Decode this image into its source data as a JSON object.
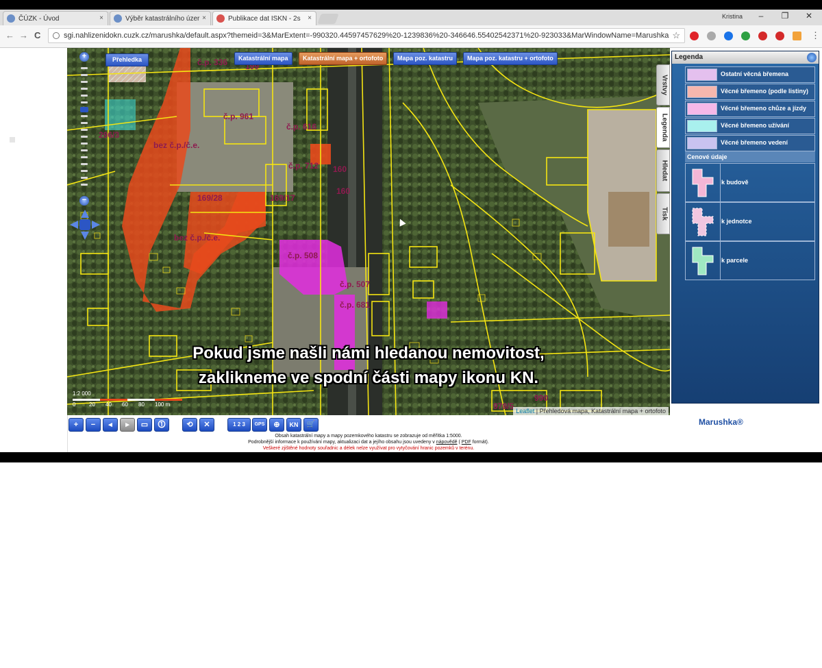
{
  "browser": {
    "tabs": [
      {
        "label": "ČÚZK - Úvod",
        "close": "×"
      },
      {
        "label": "Výběr katastrálního úzer",
        "close": "×"
      },
      {
        "label": "Publikace dat ISKN - 2s",
        "close": "×"
      }
    ],
    "user": "Kristina",
    "window_controls": [
      "–",
      "❐",
      "✕"
    ],
    "nav": {
      "back": "←",
      "forward": "→",
      "reload": "C"
    },
    "url": "sgi.nahlizenidokn.cuzk.cz/marushka/default.aspx?themeid=3&MarExtent=-990320.44597457629%20-1239836%20-346646.55402542371%20-923033&MarWindowName=Marushka",
    "star": "☆",
    "menu": "⋮",
    "extension_colors": [
      "#e0242a",
      "#aaaaaa",
      "#1a73e8",
      "#2ea043",
      "#d42a2a",
      "#d42a2a",
      "#f2a23a"
    ]
  },
  "map": {
    "layer_buttons": [
      {
        "label": "Přehledka",
        "active": false
      },
      {
        "label": "Katastrální mapa",
        "active": false
      },
      {
        "label": "Katastrální mapa + ortofoto",
        "active": true
      },
      {
        "label": "Mapa poz. katastru",
        "active": false
      },
      {
        "label": "Mapa poz. katastru + ortofoto",
        "active": false
      }
    ],
    "zoom": {
      "plus": "+",
      "minus": "−"
    },
    "labels": [
      {
        "text": "č.p. 336",
        "key": "cp336"
      },
      {
        "text": "199",
        "key": "n199"
      },
      {
        "text": "č.p. 961",
        "key": "cp961"
      },
      {
        "text": "č.p. 616",
        "key": "cp616"
      },
      {
        "text": "č.p. 712",
        "key": "cp712"
      },
      {
        "text": "160",
        "key": "n160a"
      },
      {
        "text": "160",
        "key": "n160b"
      },
      {
        "text": "296/3",
        "key": "n2963"
      },
      {
        "text": "bez č.p./č.e.",
        "key": "bez1"
      },
      {
        "text": "169/28",
        "key": "n16928"
      },
      {
        "text": "169/17",
        "key": "n16917"
      },
      {
        "text": "bez č.p./č.e.",
        "key": "bez2"
      },
      {
        "text": "č.p. 508",
        "key": "cp508"
      },
      {
        "text": "č.p. 507",
        "key": "cp507"
      },
      {
        "text": "č.p. 681",
        "key": "cp681"
      },
      {
        "text": "990",
        "key": "n990"
      },
      {
        "text": "978/5",
        "key": "n9785"
      }
    ],
    "scale": {
      "ratio": "1:2 000",
      "ticks": [
        "0",
        "20",
        "40",
        "60",
        "80",
        "100 m"
      ]
    },
    "attribution": {
      "link": "Leaflet",
      "text": " | Přehledová mapa, Katastrální mapa + ortofoto"
    },
    "subtitle": {
      "line1": "Pokud jsme našli námi hledanou nemovitost,",
      "line2": "zaklikneme ve spodní části mapy ikonu KN."
    }
  },
  "side_tabs": [
    "Vrstvy",
    "Legenda",
    "Hledat",
    "Tisk"
  ],
  "legend": {
    "title": "Legenda",
    "items": [
      {
        "label": "Ostatní věcná břemena",
        "color": "#e4c0ee"
      },
      {
        "label": "Věcné břemeno (podle listiny)",
        "color": "#f6b7ae"
      },
      {
        "label": "Věcné břemeno chůze a jízdy",
        "color": "#f5b8e8"
      },
      {
        "label": "Věcné břemeno užívání",
        "color": "#a9f0ee"
      },
      {
        "label": "Věcné břemeno vedení",
        "color": "#c9c3f0"
      }
    ],
    "price_section": "Cenové údaje",
    "price_items": [
      {
        "label": "k budově",
        "color": "#f4b6d6"
      },
      {
        "label": "k jednotce",
        "color": "#f0c6e0"
      },
      {
        "label": "k parcele",
        "color": "#9fe8c2"
      }
    ]
  },
  "toolbar": {
    "buttons": [
      "+",
      "−",
      "◂",
      "▸",
      "▭",
      "⓵",
      "⟲",
      "✕",
      "1 2 3",
      "GPS",
      "⊕",
      "KN",
      "🛒"
    ]
  },
  "brand": "Marushka®",
  "footer": {
    "line1": "Obsah katastrální mapy a mapy pozemkového katastru se zobrazuje od měřítka 1:5000.",
    "line2a": "Podrobnější informace k používání mapy, aktualizaci dat a jejího obsahu jsou uvedeny v",
    "line2link1": "nápovědě",
    "line2b": "(",
    "line2link2": "PDF",
    "line2c": "formát).",
    "line3": "Veškeré zjištěné hodnoty souřadnic a délek nelze využívat pro vytyčování hranic pozemků v terénu."
  }
}
